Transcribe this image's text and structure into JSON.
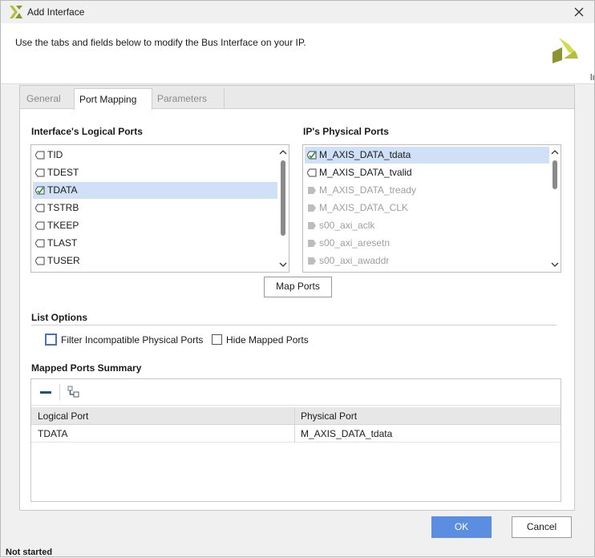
{
  "window": {
    "title": "Add Interface",
    "description": "Use the tabs and fields below to modify the Bus Interface on your IP.",
    "edge_text": "lı"
  },
  "tabs": [
    {
      "label": "General",
      "active": false
    },
    {
      "label": "Port Mapping",
      "active": true
    },
    {
      "label": "Parameters",
      "active": false
    }
  ],
  "logical_ports": {
    "label": "Interface's Logical Ports",
    "items": [
      {
        "label": "TID",
        "mapped": false,
        "selected": false
      },
      {
        "label": "TDEST",
        "mapped": false,
        "selected": false
      },
      {
        "label": "TDATA",
        "mapped": true,
        "selected": true
      },
      {
        "label": "TSTRB",
        "mapped": false,
        "selected": false
      },
      {
        "label": "TKEEP",
        "mapped": false,
        "selected": false
      },
      {
        "label": "TLAST",
        "mapped": false,
        "selected": false
      },
      {
        "label": "TUSER",
        "mapped": false,
        "selected": false
      }
    ]
  },
  "physical_ports": {
    "label": "IP's Physical Ports",
    "items": [
      {
        "label": "M_AXIS_DATA_tdata",
        "mapped": true,
        "selected": true,
        "enabled": true
      },
      {
        "label": "M_AXIS_DATA_tvalid",
        "mapped": false,
        "selected": false,
        "enabled": true
      },
      {
        "label": "M_AXIS_DATA_tready",
        "mapped": false,
        "selected": false,
        "enabled": false
      },
      {
        "label": "M_AXIS_DATA_CLK",
        "mapped": false,
        "selected": false,
        "enabled": false
      },
      {
        "label": "s00_axi_aclk",
        "mapped": false,
        "selected": false,
        "enabled": false
      },
      {
        "label": "s00_axi_aresetn",
        "mapped": false,
        "selected": false,
        "enabled": false
      },
      {
        "label": "s00_axi_awaddr",
        "mapped": false,
        "selected": false,
        "enabled": false
      }
    ]
  },
  "map_ports_button": "Map Ports",
  "list_options": {
    "label": "List Options",
    "filter_incompatible": {
      "label": "Filter Incompatible Physical Ports",
      "checked": false
    },
    "hide_mapped": {
      "label": "Hide Mapped Ports",
      "checked": false
    }
  },
  "summary": {
    "label": "Mapped Ports Summary",
    "columns": [
      "Logical Port",
      "Physical Port"
    ],
    "rows": [
      {
        "logical": "TDATA",
        "physical": "M_AXIS_DATA_tdata"
      }
    ]
  },
  "buttons": {
    "ok": "OK",
    "cancel": "Cancel"
  },
  "status": {
    "text": "Not started"
  },
  "colors": {
    "accent": "#5b8ee0",
    "selection": "#cfe0f7",
    "logo": "#b5bd3a"
  }
}
